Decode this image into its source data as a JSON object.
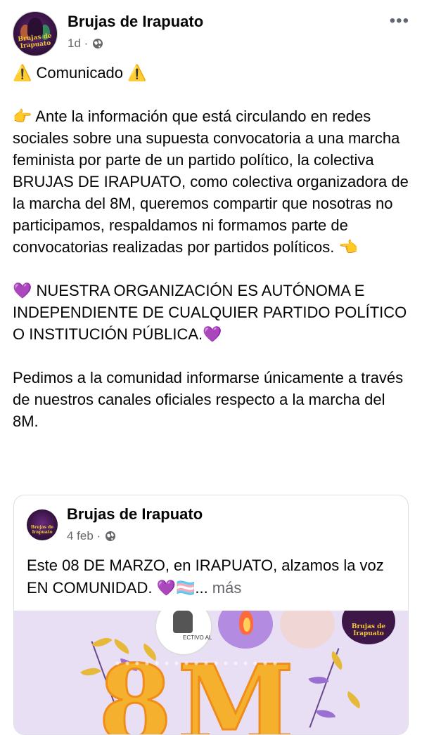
{
  "post": {
    "page_name": "Brujas de Irapuato",
    "time": "1d ·",
    "more_icon": "•••",
    "avatar_text": "Brujas de Irapuato",
    "paragraphs": [
      "⚠️ Comunicado ⚠️",
      "",
      "👉 Ante la información que está circulando en redes sociales sobre una supuesta convocatoria a una marcha feminista por parte de un partido político, la colectiva BRUJAS DE IRAPUATO, como colectiva organizadora de la marcha del 8M, queremos compartir que nosotras no participamos, respaldamos ni formamos parte de convocatorias realizadas por partidos políticos. 👈",
      "",
      "💜 NUESTRA ORGANIZACIÓN ES AUTÓNOMA E INDEPENDIENTE DE CUALQUIER PARTIDO POLÍTICO O INSTITUCIÓN PÚBLICA.💜",
      "",
      "Pedimos a la comunidad informarse únicamente a través de nuestros canales oficiales respecto a la marcha del 8M."
    ]
  },
  "shared": {
    "page_name": "Brujas de Irapuato",
    "time": "4 feb ·",
    "avatar_text": "Brujas de Irapuato",
    "text": "Este 08 DE MARZO, en IRAPUATO, alzamos la voz EN COMUNIDAD. 💜🏳️‍⚧️...",
    "more_label": " más",
    "image": {
      "big_text": "8M",
      "logo_text": "Brujas de Irapuato",
      "small_label": "ECTIVO AL"
    }
  },
  "colors": {
    "meta_gray": "#65676b",
    "accent_yellow": "#f5b12e",
    "image_bg": "#e8dff5"
  },
  "icons": [
    "globe-icon",
    "more-options-icon",
    "warning-icon",
    "pointing-right-icon",
    "pointing-left-icon",
    "purple-heart-icon",
    "trans-flag-icon"
  ]
}
